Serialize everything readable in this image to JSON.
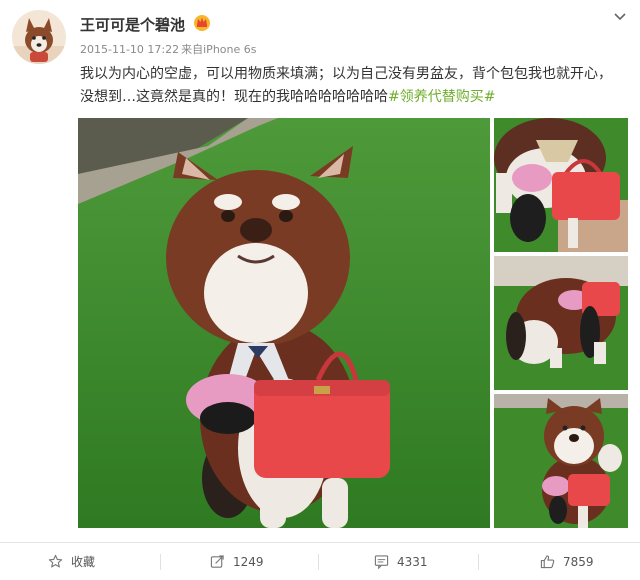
{
  "post": {
    "username": "王可可是个碧池",
    "timestamp": "2015-11-10 17:22",
    "source": "来自iPhone 6s",
    "text_before": "我以为内心的空虚，可以用物质来填满；以为自己没有男盆友，背个包包我也就开心，没想到…这竟然是真的！现在的我哈哈哈哈哈哈哈",
    "hashtag": "#领养代替购买#"
  },
  "actions": {
    "favorite_label": "收藏",
    "repost_count": "1249",
    "comment_count": "4331",
    "like_count": "7859"
  },
  "icons": {
    "badge": "vip-crown-icon",
    "menu": "chevron-down-icon",
    "favorite": "star-icon",
    "repost": "repost-icon",
    "comment": "comment-icon",
    "like": "thumbs-up-icon"
  },
  "colors": {
    "hashtag": "#6fae2b",
    "grass": "#3f8a2a",
    "bag": "#e8484a"
  }
}
